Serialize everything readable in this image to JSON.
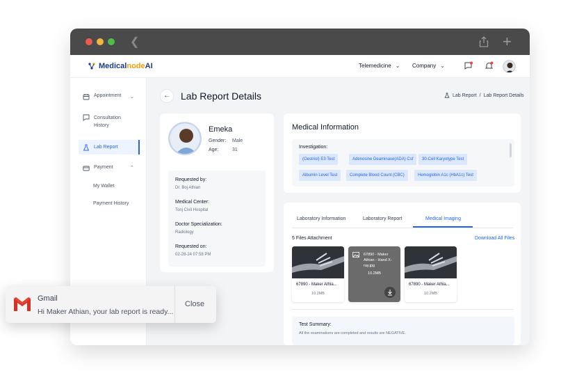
{
  "brand": {
    "part1": "Medical",
    "part2": "node",
    "part3": "AI"
  },
  "topnav": {
    "telemedicine": "Telemedicine",
    "company": "Company"
  },
  "sidebar": {
    "appointment": "Appointment",
    "consultation_line1": "Consultation",
    "consultation_line2": "History",
    "lab_report": "Lab Report",
    "payment": "Payment",
    "my_wallet": "My Wallet",
    "payment_history": "Payment History"
  },
  "page": {
    "title": "Lab Report Details",
    "breadcrumb_parent": "Lab Report",
    "breadcrumb_sep": "/",
    "breadcrumb_current": "Lab Report Details"
  },
  "patient": {
    "name": "Emeka",
    "gender_label": "Gender:",
    "gender": "Male",
    "age_label": "Age:",
    "age": "31",
    "requested_by_label": "Requested by:",
    "requested_by": "Dr. Boj Athian",
    "medical_center_label": "Medical Center:",
    "medical_center": "Tonj Civil Hospital",
    "specialization_label": "Doctor Specialization:",
    "specialization": "Radiology",
    "requested_on_label": "Requested on:",
    "requested_on": "02-28-24 07:58 PM"
  },
  "medical_info": {
    "title": "Medical Information",
    "investigation_label": "Investigation:",
    "tests": [
      "(Oestriol) E3 Test",
      "Adenosine Deaminase(ADA) Csf",
      "30-Cell Karyotype Test",
      "Albumin Level Test",
      "Complete Blood Count (CBC)",
      "Hemoglobin A1c (HbA1c) Test"
    ]
  },
  "tabs": {
    "lab_info": "Laboratory Information",
    "lab_report": "Laboratory Report",
    "imaging": "Medical Imaging"
  },
  "files": {
    "title": "5 Files Attachment",
    "download_all": "Download All Files",
    "items": [
      {
        "name": "67890 - Maker Athia...",
        "size": "10.2MB"
      },
      {
        "name": "67890 - Maker Athian - Hand X-ray.jpg",
        "size": "10.2MB"
      },
      {
        "name": "67890 - Maker Athia...",
        "size": "10.2MB"
      }
    ]
  },
  "summary": {
    "title": "Test Summary:",
    "text": "All the examinations are completed and results are NEGATIVE."
  },
  "toast": {
    "app": "Gmail",
    "message": "Hi Maker Athian, your lab report is ready...",
    "close": "Close"
  },
  "colors": {
    "accent": "#2563eb",
    "brand_orange": "#f59e0b",
    "titlebar": "#4a4a4a"
  }
}
